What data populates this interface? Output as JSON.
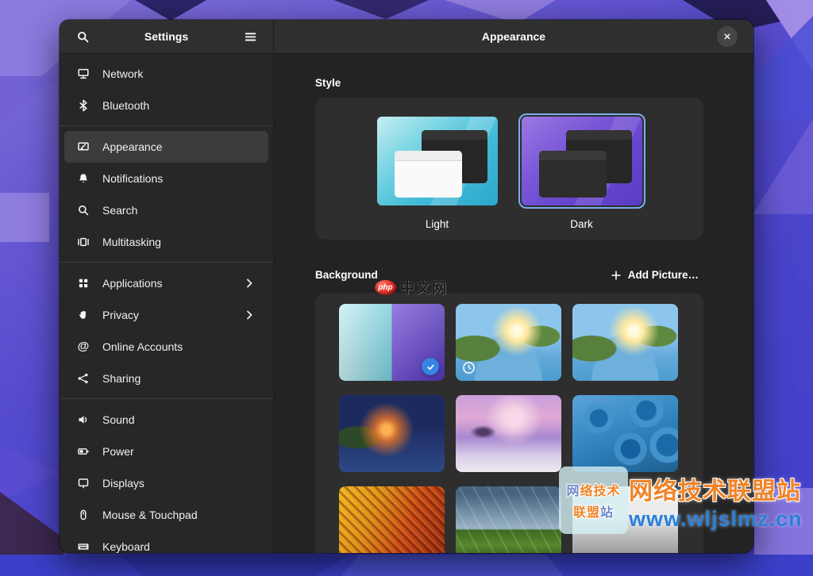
{
  "window": {
    "sidebar_header": {
      "title": "Settings"
    },
    "content_header": {
      "title": "Appearance"
    }
  },
  "sidebar": {
    "items": [
      {
        "label": "Network",
        "icon": "network-icon"
      },
      {
        "label": "Bluetooth",
        "icon": "bluetooth-icon"
      },
      {
        "label": "Appearance",
        "icon": "appearance-icon",
        "selected": true
      },
      {
        "label": "Notifications",
        "icon": "bell-icon"
      },
      {
        "label": "Search",
        "icon": "search-icon"
      },
      {
        "label": "Multitasking",
        "icon": "multitasking-icon"
      },
      {
        "label": "Applications",
        "icon": "app-grid-icon",
        "chevron": true
      },
      {
        "label": "Privacy",
        "icon": "hand-icon",
        "chevron": true
      },
      {
        "label": "Online Accounts",
        "icon": "at-icon"
      },
      {
        "label": "Sharing",
        "icon": "share-icon"
      },
      {
        "label": "Sound",
        "icon": "speaker-icon"
      },
      {
        "label": "Power",
        "icon": "battery-icon"
      },
      {
        "label": "Displays",
        "icon": "display-icon"
      },
      {
        "label": "Mouse & Touchpad",
        "icon": "mouse-icon"
      },
      {
        "label": "Keyboard",
        "icon": "keyboard-icon"
      }
    ]
  },
  "style_section": {
    "title": "Style",
    "options": [
      {
        "label": "Light",
        "selected": false
      },
      {
        "label": "Dark",
        "selected": true
      }
    ]
  },
  "background_section": {
    "title": "Background",
    "add_picture_label": "Add Picture…",
    "wallpapers": [
      {
        "name": "default-split-light-dark",
        "selected": true
      },
      {
        "name": "landscape-day",
        "dynamic": true
      },
      {
        "name": "landscape-day-alt"
      },
      {
        "name": "landscape-night"
      },
      {
        "name": "winter-sunset"
      },
      {
        "name": "blue-knots"
      },
      {
        "name": "orange-fabric-macro"
      },
      {
        "name": "green-field-sky"
      },
      {
        "name": "monochrome-scene"
      }
    ]
  },
  "watermarks": {
    "php": {
      "logo_text": "php",
      "site_text": "中文网"
    },
    "wljslmz": {
      "box_line1_a": "网",
      "box_line1_b": "络技术",
      "box_line2_a": "联盟",
      "box_line2_b": "站",
      "title": "网络技术联盟站",
      "url": "www.wljslmz.cn"
    }
  },
  "colors": {
    "accent": "#3584e4",
    "selection_ring": "#78aeed",
    "headerbar": "#2f2f2f",
    "sidebar": "#272727",
    "content": "#232323",
    "card": "#2e2e2e"
  }
}
